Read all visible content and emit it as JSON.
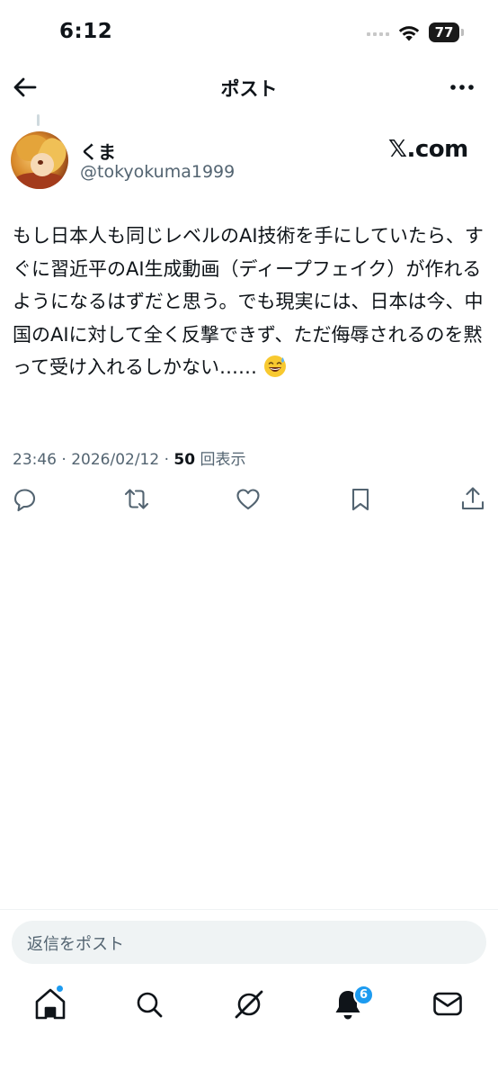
{
  "status_bar": {
    "time": "6:12",
    "battery": "77"
  },
  "nav": {
    "title": "ポスト"
  },
  "post": {
    "author_name": "くま",
    "author_handle": "@tokyokuma1999",
    "watermark": "𝕏.com",
    "text": "もし日本人も同じレベルのAI技術を手にしていたら、すぐに習近平のAI生成動画（ディープフェイク）が作れるようになるはずだと思う。でも現実には、日本は今、中国のAIに対して全く反撃できず、ただ侮辱されるのを黙って受け入れるしかない……",
    "emoji": "sweat-smile-emoji",
    "timestamp": "23:46 · 2026/02/12 · ",
    "views_count": "50",
    "views_label": " 回表示"
  },
  "actions": [
    "reply-icon",
    "repost-icon",
    "like-icon",
    "bookmark-icon",
    "share-icon"
  ],
  "reply_bar": {
    "placeholder": "返信をポスト"
  },
  "tabbar": {
    "items": [
      "home-icon",
      "search-icon",
      "grok-icon",
      "notifications-icon",
      "messages-icon"
    ],
    "notifications_badge": "6"
  },
  "colors": {
    "accent": "#1d9bf0",
    "text": "#0f1419",
    "secondary": "#536471"
  }
}
